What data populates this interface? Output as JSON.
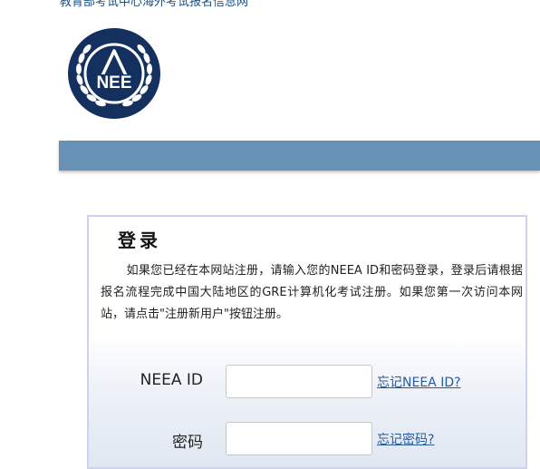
{
  "header": {
    "top_link": "教育部考试中心海外考试报名信息网"
  },
  "logo": {
    "text": "NEE",
    "colors": {
      "navy": "#13305f",
      "white": "#ffffff"
    }
  },
  "login": {
    "title": "登录",
    "description": "如果您已经在本网站注册，请输入您的NEEA ID和密码登录，登录后请根据报名流程完成中国大陆地区的GRE计算机化考试注册。如果您第一次访问本网站，请点击\"注册新用户\"按钮注册。",
    "neea_id_label": "NEEA ID",
    "neea_id_value": "",
    "forgot_id_link": "忘记NEEA ID?",
    "password_label": "密码",
    "password_value": "",
    "forgot_password_link": "忘记密码?"
  },
  "colors": {
    "nav_bar": "#6892b5",
    "link": "#2a5a9a",
    "panel_border": "#cfd2ef"
  }
}
